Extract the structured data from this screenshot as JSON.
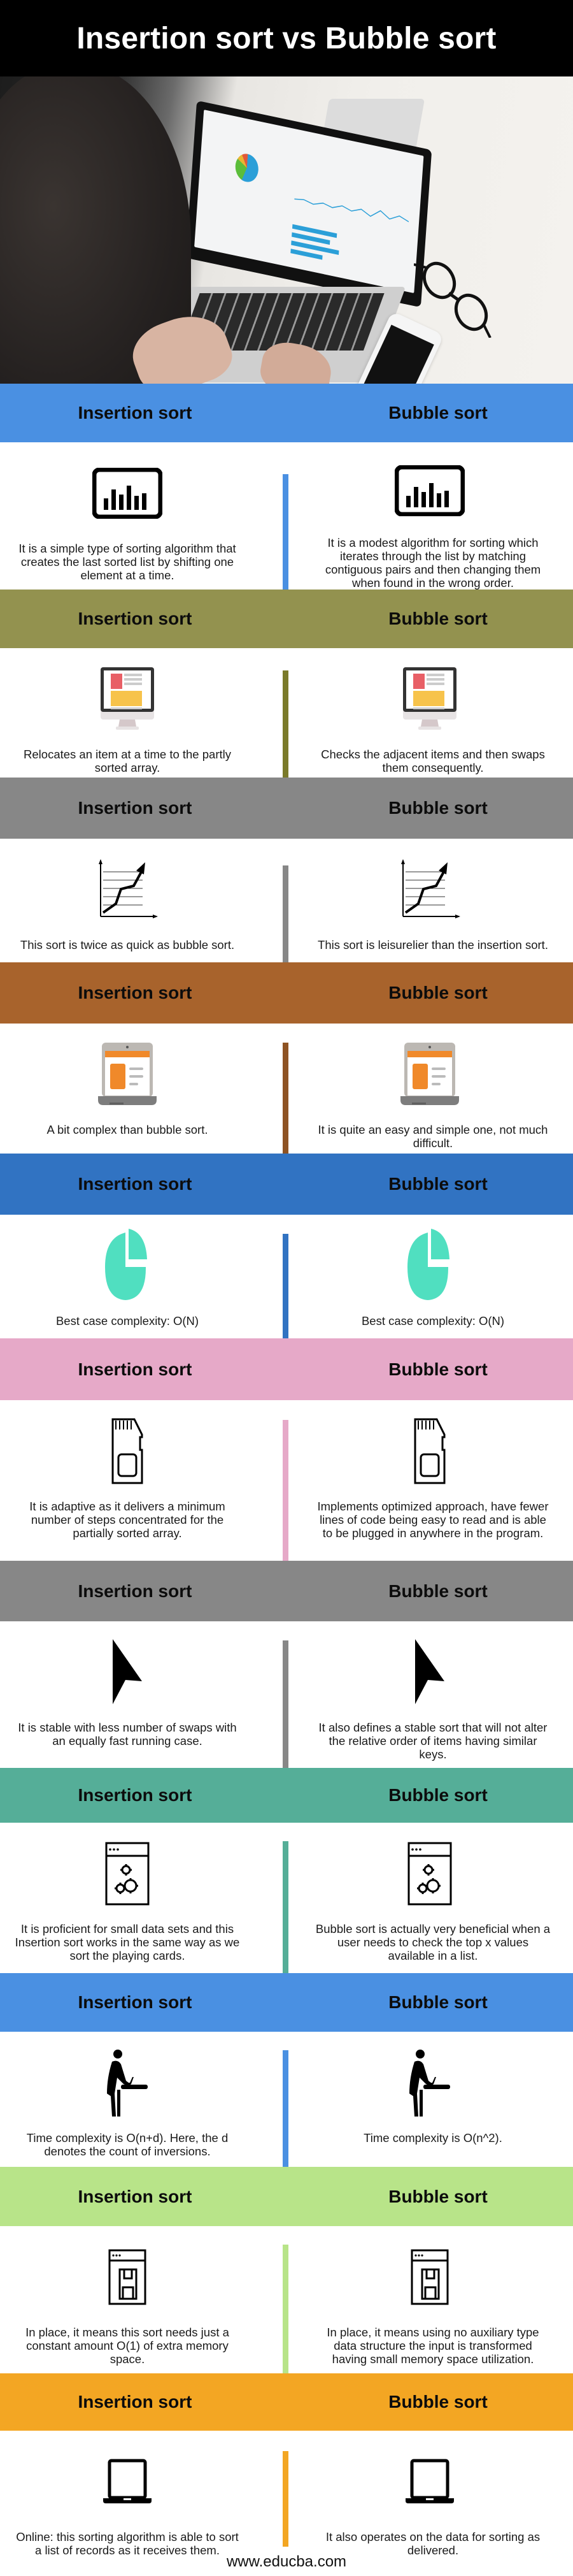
{
  "title": "Insertion sort vs Bubble sort",
  "hero_photo": {
    "description": "Person typing on a laptop showing analytics dashboard, with glasses and phone on desk"
  },
  "column_labels": {
    "left": "Insertion sort",
    "right": "Bubble sort"
  },
  "sections": [
    {
      "color": "#4A90E2",
      "icon": "bar-chart-icon",
      "left_text": "It is a simple type of sorting algorithm that creates the last sorted list by shifting one element at a time.",
      "right_text": "It is a modest algorithm for sorting which iterates through the list by matching contiguous pairs and then changing them when found in the wrong order."
    },
    {
      "color": "#93924F",
      "divider_color": "#7A7A2A",
      "icon": "monitor-icon",
      "left_text": "Relocates an item at a time to the partly sorted array.",
      "right_text": "Checks the adjacent items and then swaps them consequently."
    },
    {
      "color": "#878787",
      "icon": "growth-chart-icon",
      "left_text": "This sort is twice as quick as bubble sort.",
      "right_text": "This sort is leisurelier than the insertion sort."
    },
    {
      "color": "#A8632C",
      "divider_color": "#8E5323",
      "icon": "laptop-icon",
      "left_text": "A bit complex than bubble sort.",
      "right_text": "It is quite an easy and simple one, not much difficult."
    },
    {
      "color": "#3173C2",
      "icon": "pie-chart-icon",
      "left_text": "Best case complexity: O(N)",
      "right_text": "Best case complexity: O(N)"
    },
    {
      "color": "#E6A9C8",
      "icon": "sd-card-icon",
      "left_text": "It is adaptive as it delivers a minimum number of steps concentrated for the partially sorted array.",
      "right_text": "Implements optimized approach, have fewer lines of code being easy to read and is able to be plugged in anywhere in the program."
    },
    {
      "color": "#878787",
      "icon": "cursor-arrow-icon",
      "left_text": "It is stable with less number of swaps with an equally fast running case.",
      "right_text": "It also defines a stable sort that will not alter the relative order of items having similar keys."
    },
    {
      "color": "#55AE98",
      "icon": "settings-window-icon",
      "left_text": "It is proficient for small data sets and this Insertion sort works in the same way as we sort the playing cards.",
      "right_text": "Bubble sort is actually very beneficial when a user needs to check the top x values available in a list."
    },
    {
      "color": "#4A90E2",
      "icon": "person-at-laptop-icon",
      "left_text": "Time complexity is O(n+d). Here, the d denotes the count of inversions.",
      "right_text": "Time complexity is O(n^2)."
    },
    {
      "color": "#B8E489",
      "icon": "save-window-icon",
      "left_text": "In place, it means this sort needs just a constant amount O(1) of extra memory space.",
      "right_text": "In place, it means using no auxiliary type data structure the input is transformed having small memory space utilization."
    },
    {
      "color": "#F3A623",
      "icon": "laptop-outline-icon",
      "left_text": "Online: this sorting algorithm is able to sort a list of records as it receives them.",
      "right_text": "It also operates on the data for sorting as delivered."
    }
  ],
  "footer": {
    "url": "www.educba.com"
  }
}
